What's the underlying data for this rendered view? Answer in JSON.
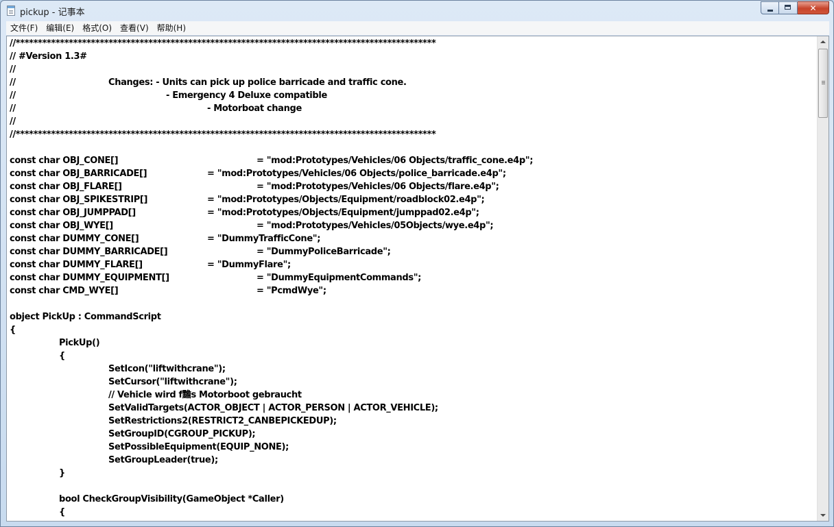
{
  "window": {
    "title": "pickup - 记事本"
  },
  "menu": [
    {
      "label": "文件(F)"
    },
    {
      "label": "编辑(E)"
    },
    {
      "label": "格式(O)"
    },
    {
      "label": "查看(V)"
    },
    {
      "label": "帮助(H)"
    }
  ],
  "lines": [
    {
      "text": "//***********************************************************************************************"
    },
    {
      "text": "// #Version 1.3#"
    },
    {
      "text": "//"
    },
    {
      "text": "//"
    },
    {
      "text": "//"
    },
    {
      "text": "//"
    },
    {
      "text": "//"
    },
    {
      "text": "//***********************************************************************************************"
    },
    {
      "text": ""
    },
    {
      "text": "const char OBJ_CONE[]"
    },
    {
      "text": "const char OBJ_BARRICADE[]"
    },
    {
      "text": "const char OBJ_FLARE[]"
    },
    {
      "text": "const char OBJ_SPIKESTRIP[]"
    },
    {
      "text": "const char OBJ_JUMPPAD[]"
    },
    {
      "text": "const char OBJ_WYE[]"
    },
    {
      "text": "const char DUMMY_CONE[]"
    },
    {
      "text": "const char DUMMY_BARRICADE[]"
    },
    {
      "text": "const char DUMMY_FLARE[]"
    },
    {
      "text": "const char DUMMY_EQUIPMENT[]"
    },
    {
      "text": "const char CMD_WYE[]"
    },
    {
      "text": ""
    },
    {
      "text": "object PickUp : CommandScript"
    },
    {
      "text": "{"
    },
    {
      "text": ""
    },
    {
      "text": ""
    },
    {
      "text": ""
    },
    {
      "text": ""
    },
    {
      "text": ""
    },
    {
      "text": ""
    },
    {
      "text": ""
    },
    {
      "text": ""
    },
    {
      "text": ""
    },
    {
      "text": ""
    },
    {
      "text": ""
    },
    {
      "text": ""
    },
    {
      "text": ""
    },
    {
      "text": ""
    }
  ],
  "segments": [
    {
      "text": "Changes: - Units can pick up police barricade and traffic cone."
    },
    {
      "text": "- Emergency 4 Deluxe compatible"
    },
    {
      "text": "- Motorboat change"
    },
    {
      "text": "= \"mod:Prototypes/Vehicles/06 Objects/traffic_cone.e4p\";"
    },
    {
      "text": "= \"mod:Prototypes/Vehicles/06 Objects/police_barricade.e4p\";"
    },
    {
      "text": "= \"mod:Prototypes/Vehicles/06 Objects/flare.e4p\";"
    },
    {
      "text": "= \"mod:Prototypes/Objects/Equipment/roadblock02.e4p\";"
    },
    {
      "text": "= \"mod:Prototypes/Objects/Equipment/jumppad02.e4p\";"
    },
    {
      "text": "= \"mod:Prototypes/Vehicles/05Objects/wye.e4p\";"
    },
    {
      "text": "= \"DummyTrafficCone\";"
    },
    {
      "text": "= \"DummyPoliceBarricade\";"
    },
    {
      "text": "= \"DummyFlare\";"
    },
    {
      "text": "= \"DummyEquipmentCommands\";"
    },
    {
      "text": "= \"PcmdWye\";"
    },
    {
      "text": "PickUp()"
    },
    {
      "text": "{"
    },
    {
      "text": "SetIcon(\"liftwithcrane\");"
    },
    {
      "text": "SetCursor(\"liftwithcrane\");"
    },
    {
      "text": "// Vehicle wird f黵s Motorboot gebraucht"
    },
    {
      "text": "SetValidTargets(ACTOR_OBJECT | ACTOR_PERSON | ACTOR_VEHICLE);"
    },
    {
      "text": "SetRestrictions2(RESTRICT2_CANBEPICKEDUP);"
    },
    {
      "text": "SetGroupID(CGROUP_PICKUP);"
    },
    {
      "text": "SetPossibleEquipment(EQUIP_NONE);"
    },
    {
      "text": "SetGroupLeader(true);"
    },
    {
      "text": "}"
    },
    {
      "text": "bool CheckGroupVisibility(GameObject *Caller)"
    },
    {
      "text": "{"
    }
  ]
}
